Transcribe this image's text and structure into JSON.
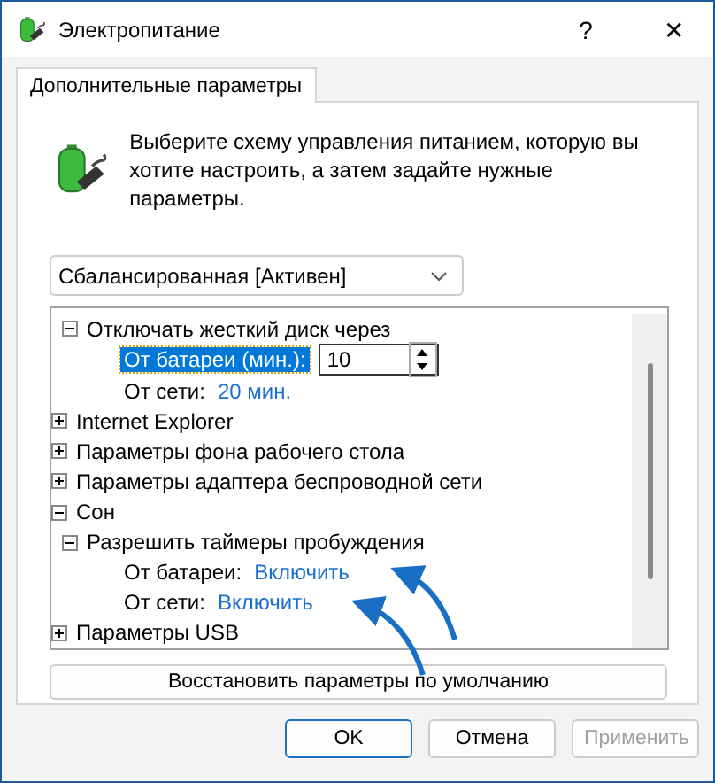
{
  "window": {
    "title": "Электропитание",
    "help": "?",
    "close": "✕"
  },
  "tabs": [
    {
      "label": "Дополнительные параметры",
      "selected": true
    }
  ],
  "intro": "Выберите схему управления питанием, которую вы хотите настроить, а затем задайте нужные параметры.",
  "plan_select": {
    "value": "Сбалансированная [Активен]"
  },
  "tree": [
    {
      "children": [
        {
          "label": "Отключать жесткий диск через",
          "expanded": true,
          "children": [
            {
              "kind": "setting",
              "label": "От батареи (мин.):",
              "value": "10",
              "selected": true,
              "editing": true
            },
            {
              "kind": "setting",
              "label": "От сети:",
              "value": "20 мин.",
              "selected": false,
              "editing": false
            }
          ]
        }
      ]
    },
    {
      "label": "Internet Explorer",
      "expanded": false
    },
    {
      "label": "Параметры фона рабочего стола",
      "expanded": false
    },
    {
      "label": "Параметры адаптера беспроводной сети",
      "expanded": false
    },
    {
      "label": "Сон",
      "expanded": true,
      "children": [
        {
          "label": "Разрешить таймеры пробуждения",
          "expanded": true,
          "children": [
            {
              "kind": "setting",
              "label": "От батареи:",
              "value": "Включить",
              "selected": false,
              "editing": false
            },
            {
              "kind": "setting",
              "label": "От сети:",
              "value": "Включить",
              "selected": false,
              "editing": false
            }
          ]
        }
      ]
    },
    {
      "label": "Параметры USB",
      "expanded": false
    }
  ],
  "restore_button": "Восстановить параметры по умолчанию",
  "buttons": [
    {
      "label": "OK",
      "default": true,
      "disabled": false
    },
    {
      "label": "Отмена",
      "default": false,
      "disabled": false
    },
    {
      "label": "Применить",
      "default": false,
      "disabled": true
    }
  ]
}
